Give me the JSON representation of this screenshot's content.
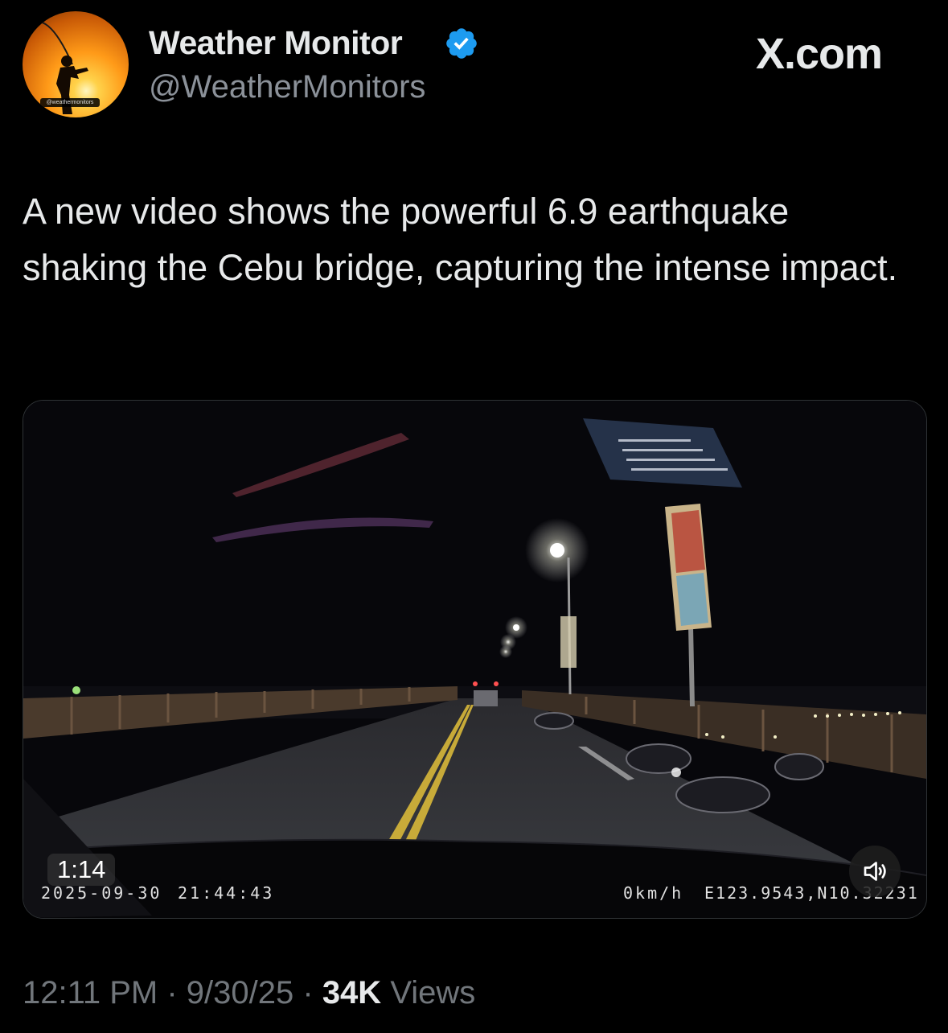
{
  "author": {
    "display_name": "Weather Monitor",
    "handle": "@WeatherMonitors",
    "avatar_caption": "@weathermonitors",
    "verified": true
  },
  "brand": {
    "watermark": "X.com"
  },
  "tweet": {
    "text": "A new video shows the powerful 6.9 earthquake shaking the Cebu bridge, capturing the intense impact."
  },
  "video": {
    "duration": "1:14",
    "dashcam_date": "2025-09-30",
    "dashcam_time": "21:44:43",
    "dashcam_speed": "0km/h",
    "dashcam_gps": "E123.9543,N10.32231",
    "volume_icon": "speaker-icon"
  },
  "footer": {
    "time": "12:11 PM",
    "separator": " · ",
    "date": "9/30/25",
    "views_count": "34K",
    "views_label": "Views"
  },
  "colors": {
    "background": "#000000",
    "primary_text": "#e7e9ea",
    "secondary_text": "#71767b",
    "verified": "#1d9bf0"
  }
}
